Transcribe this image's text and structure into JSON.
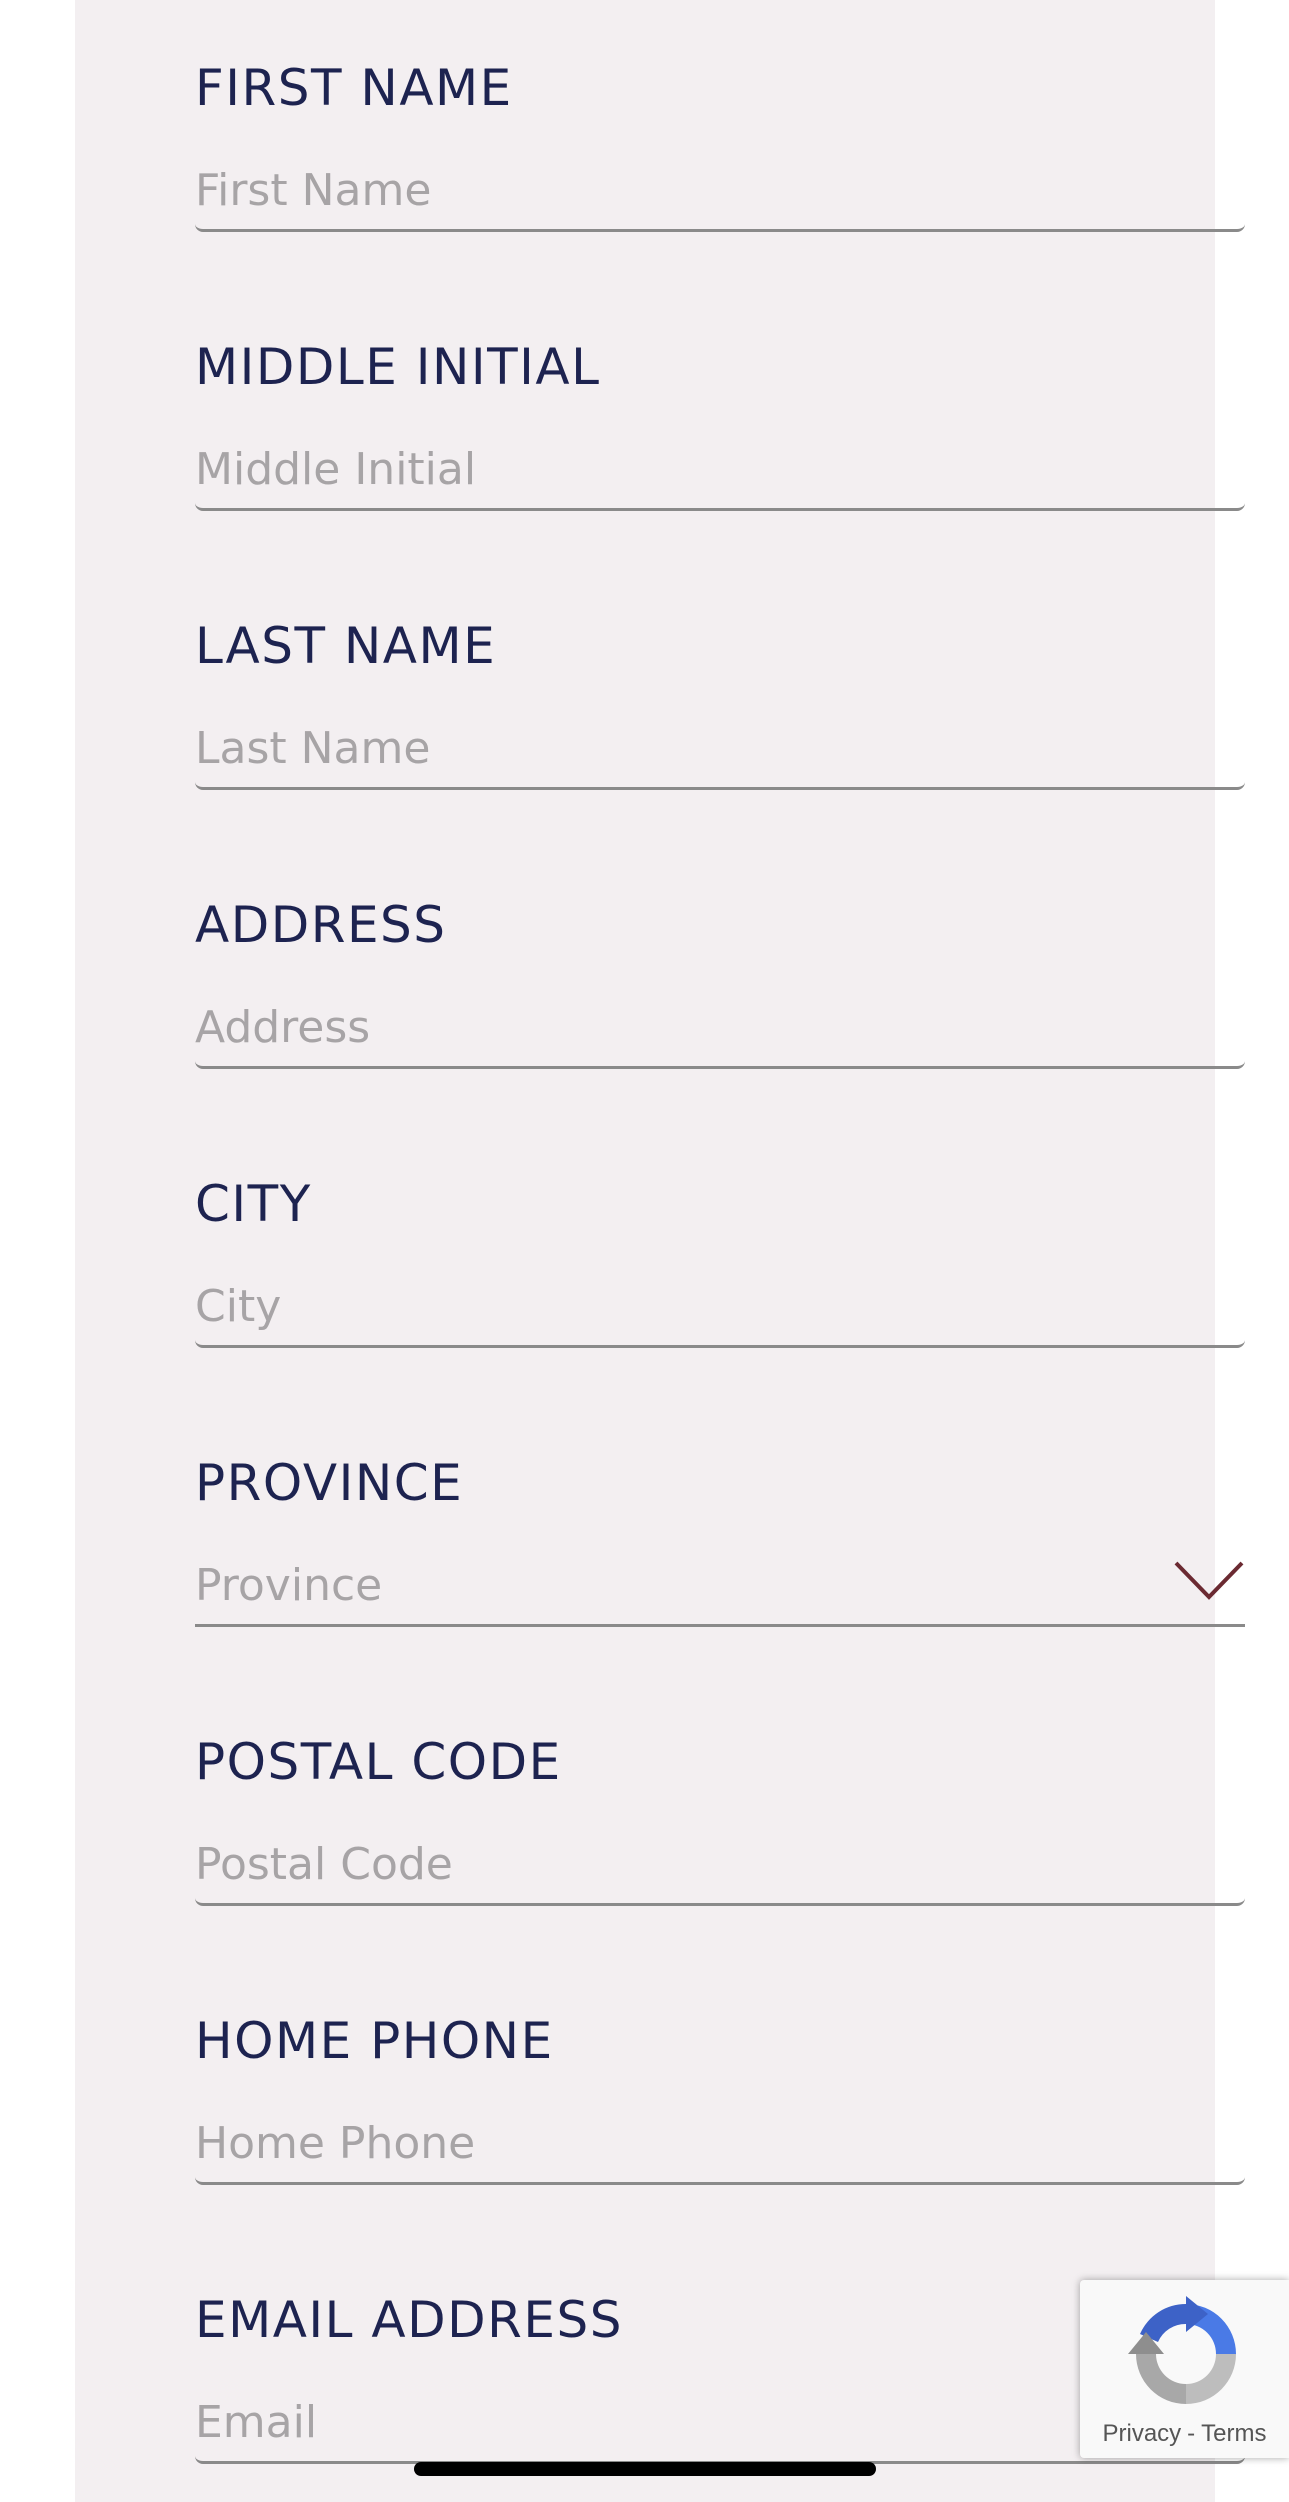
{
  "form": {
    "fields": [
      {
        "label": "FIRST NAME",
        "placeholder": "First Name",
        "type": "text"
      },
      {
        "label": "MIDDLE INITIAL",
        "placeholder": "Middle Initial",
        "type": "text"
      },
      {
        "label": "LAST NAME",
        "placeholder": "Last Name",
        "type": "text"
      },
      {
        "label": "ADDRESS",
        "placeholder": "Address",
        "type": "text"
      },
      {
        "label": "CITY",
        "placeholder": "City",
        "type": "text"
      },
      {
        "label": "PROVINCE",
        "placeholder": "Province",
        "type": "select"
      },
      {
        "label": "POSTAL CODE",
        "placeholder": "Postal Code",
        "type": "text"
      },
      {
        "label": "HOME PHONE",
        "placeholder": "Home Phone",
        "type": "text"
      },
      {
        "label": "EMAIL ADDRESS",
        "placeholder": "Email",
        "type": "text"
      }
    ]
  },
  "recaptcha": {
    "privacy_label": "Privacy",
    "separator": "-",
    "terms_label": "Terms",
    "icon": "recaptcha-icon"
  },
  "colors": {
    "label": "#1d2350",
    "placeholder": "#a7a4a6",
    "panel": "#f3eff1",
    "chevron": "#6b2a32"
  }
}
